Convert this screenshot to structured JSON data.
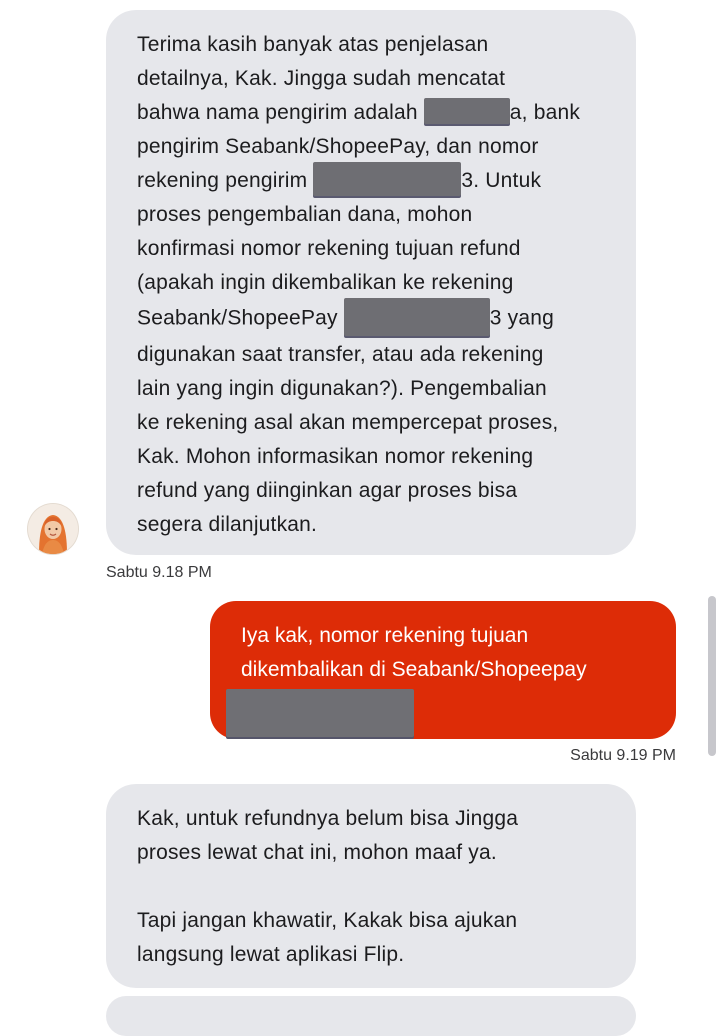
{
  "messages": {
    "bot1": {
      "line1": "Terima kasih banyak atas penjelasan",
      "line2": "detailnya, Kak. Jingga sudah mencatat",
      "line3_before": "bahwa nama pengirim adalah ",
      "line3_after": "a, bank",
      "line4": "pengirim Seabank/ShopeePay, dan nomor",
      "line5_before": "rekening pengirim ",
      "line5_after": "3. Untuk",
      "line6": "proses pengembalian dana, mohon",
      "line7": "konfirmasi nomor rekening tujuan refund",
      "line8": "(apakah ingin dikembalikan ke rekening",
      "line9_before": "Seabank/ShopeePay ",
      "line9_after": "3 yang",
      "line10": "digunakan saat transfer, atau ada rekening",
      "line11": "lain yang ingin digunakan?). Pengembalian",
      "line12": "ke rekening asal akan mempercepat proses,",
      "line13": "Kak. Mohon informasikan nomor rekening",
      "line14": "refund yang diinginkan agar proses bisa",
      "line15": "segera dilanjutkan.",
      "timestamp": "Sabtu 9.18 PM"
    },
    "user1": {
      "line1": "Iya kak, nomor rekening tujuan",
      "line2": "dikembalikan di Seabank/Shopeepay",
      "timestamp": "Sabtu 9.19 PM"
    },
    "bot2": {
      "para1_line1": "Kak, untuk refundnya belum bisa Jingga",
      "para1_line2": "proses lewat chat ini, mohon maaf ya.",
      "para2_line1": "Tapi jangan khawatir, Kakak bisa ajukan",
      "para2_line2": "langsung lewat aplikasi Flip."
    }
  },
  "avatar_icon": "agent-avatar-icon",
  "colors": {
    "bot_bubble": "#e6e7eb",
    "user_bubble": "#dd2c07",
    "redaction": "#6e6e73",
    "timestamp_text": "#3a3a3c"
  }
}
